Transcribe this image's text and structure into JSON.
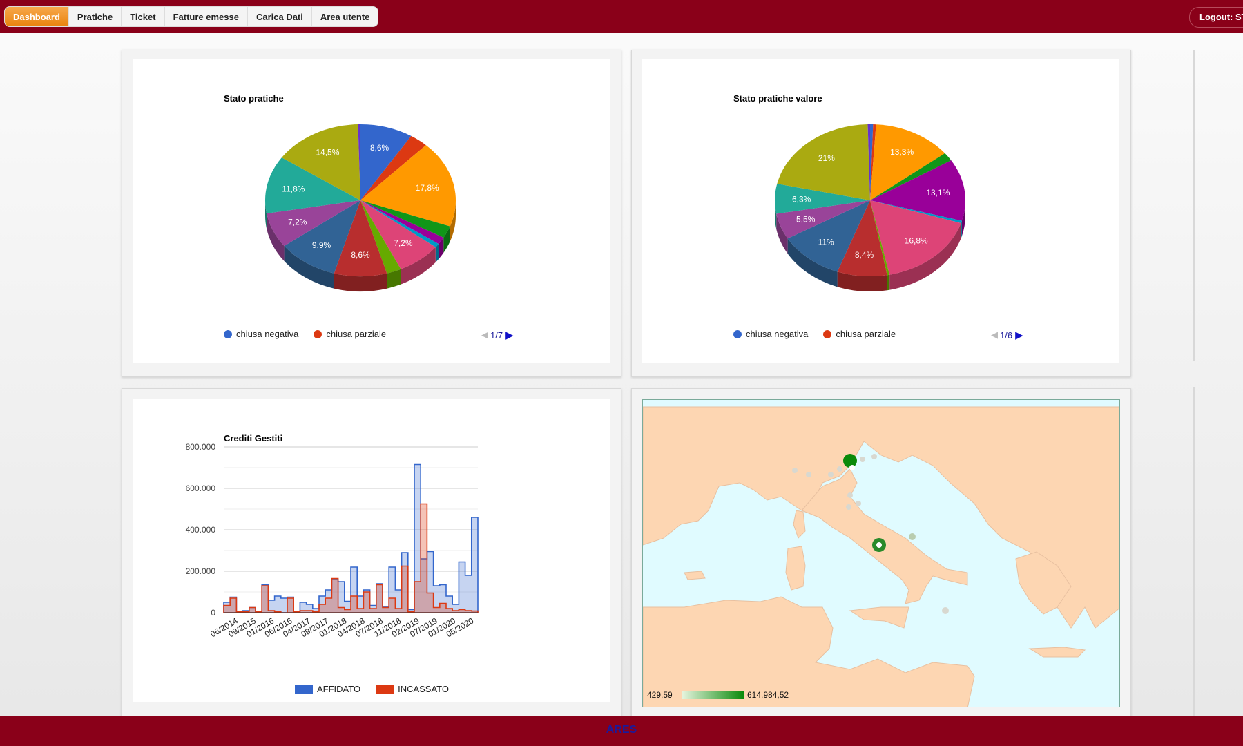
{
  "nav": {
    "items": [
      "Dashboard",
      "Pratiche",
      "Ticket",
      "Fatture emesse",
      "Carica Dati",
      "Area utente"
    ],
    "active": "Dashboard",
    "logout_label": "Logout: ST"
  },
  "panels": {
    "pie1": {
      "title": "Stato pratiche",
      "legend": [
        {
          "label": "chiusa negativa",
          "color": "#3366cc"
        },
        {
          "label": "chiusa parziale",
          "color": "#dc3912"
        }
      ],
      "pager": "1/7"
    },
    "pie2": {
      "title": "Stato pratiche valore",
      "legend": [
        {
          "label": "chiusa negativa",
          "color": "#3366cc"
        },
        {
          "label": "chiusa parziale",
          "color": "#dc3912"
        }
      ],
      "pager": "1/6"
    },
    "bar": {
      "title": "Crediti Gestiti",
      "legend": [
        {
          "label": "AFFIDATO",
          "color": "#3366cc"
        },
        {
          "label": "INCASSATO",
          "color": "#dc3912"
        }
      ]
    },
    "map": {
      "scale_min": "429,59",
      "scale_max": "614.984,52"
    }
  },
  "footer": {
    "brand": "ARES"
  },
  "chart_data": [
    {
      "type": "pie",
      "title": "Stato pratiche",
      "slices": [
        {
          "label": "chiusa negativa",
          "value": 8.6,
          "color": "#3366cc"
        },
        {
          "label": "chiusa parziale",
          "value": 3.0,
          "color": "#dc3912"
        },
        {
          "value": 17.8,
          "color": "#ff9900"
        },
        {
          "value": 2.5,
          "color": "#109618"
        },
        {
          "value": 1.5,
          "color": "#990099"
        },
        {
          "value": 0.8,
          "color": "#0099c6"
        },
        {
          "value": 7.2,
          "color": "#dd4477"
        },
        {
          "value": 2.4,
          "color": "#66aa00"
        },
        {
          "value": 8.6,
          "color": "#b82e2e"
        },
        {
          "value": 9.9,
          "color": "#316395"
        },
        {
          "value": 7.2,
          "color": "#994499"
        },
        {
          "value": 11.8,
          "color": "#22aa99"
        },
        {
          "value": 14.5,
          "color": "#aaaa11"
        },
        {
          "value": 0.4,
          "color": "#6633cc"
        }
      ]
    },
    {
      "type": "pie",
      "title": "Stato pratiche valore",
      "slices": [
        {
          "label": "chiusa negativa",
          "value": 0.5,
          "color": "#3366cc"
        },
        {
          "label": "chiusa parziale",
          "value": 0.5,
          "color": "#dc3912"
        },
        {
          "value": 13.3,
          "color": "#ff9900"
        },
        {
          "value": 1.8,
          "color": "#109618"
        },
        {
          "value": 13.1,
          "color": "#990099"
        },
        {
          "value": 0.5,
          "color": "#0099c6"
        },
        {
          "value": 16.8,
          "color": "#dd4477"
        },
        {
          "value": 0.4,
          "color": "#66aa00"
        },
        {
          "value": 8.4,
          "color": "#b82e2e"
        },
        {
          "value": 11.0,
          "color": "#316395"
        },
        {
          "value": 5.5,
          "color": "#994499"
        },
        {
          "value": 6.3,
          "color": "#22aa99"
        },
        {
          "value": 21.0,
          "color": "#aaaa11"
        },
        {
          "value": 0.4,
          "color": "#6633cc"
        }
      ]
    },
    {
      "type": "area",
      "title": "Crediti Gestiti",
      "ylim": [
        0,
        800000
      ],
      "yticks": [
        "800.000",
        "600.000",
        "400.000",
        "200.000",
        "0"
      ],
      "ytick_values": [
        800000,
        600000,
        400000,
        200000,
        0
      ],
      "xticks": [
        "06/2014",
        "09/2015",
        "01/2016",
        "06/2016",
        "04/2017",
        "09/2017",
        "01/2018",
        "04/2018",
        "07/2018",
        "11/2018",
        "02/2019",
        "07/2019",
        "01/2020",
        "05/2020"
      ],
      "series": [
        {
          "name": "AFFIDATO",
          "color": "#3366cc",
          "values": [
            50000,
            75000,
            5000,
            10000,
            25000,
            5000,
            135000,
            60000,
            80000,
            70000,
            75000,
            5000,
            50000,
            40000,
            20000,
            80000,
            110000,
            160000,
            150000,
            55000,
            220000,
            80000,
            110000,
            35000,
            140000,
            30000,
            220000,
            110000,
            290000,
            15000,
            715000,
            260000,
            295000,
            130000,
            135000,
            80000,
            40000,
            245000,
            180000,
            460000
          ]
        },
        {
          "name": "INCASSATO",
          "color": "#dc3912",
          "values": [
            35000,
            70000,
            5000,
            5000,
            25000,
            5000,
            130000,
            10000,
            5000,
            0,
            70000,
            5000,
            10000,
            10000,
            5000,
            40000,
            70000,
            165000,
            25000,
            15000,
            80000,
            20000,
            100000,
            20000,
            135000,
            25000,
            70000,
            20000,
            225000,
            5000,
            150000,
            525000,
            95000,
            25000,
            45000,
            20000,
            10000,
            15000,
            10000,
            8000
          ]
        }
      ]
    }
  ]
}
